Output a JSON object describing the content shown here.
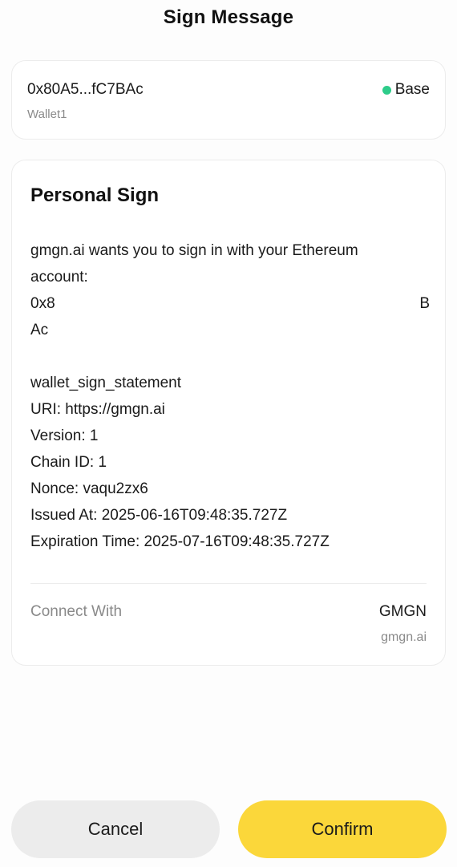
{
  "header": {
    "title": "Sign Message"
  },
  "wallet": {
    "address": "0x80A5...fC7BAc",
    "name": "Wallet1",
    "network": "Base",
    "network_status_color": "#2ecc8a"
  },
  "sign": {
    "title": "Personal Sign",
    "lines": [
      "gmgn.ai wants you to sign in with your Ethereum",
      "account:"
    ],
    "address_line_start": "0x8",
    "address_line_end": "B",
    "address_line2": "Ac",
    "fields": [
      "wallet_sign_statement",
      "URI: https://gmgn.ai",
      "Version: 1",
      "Chain ID: 1",
      "Nonce: vaqu2zx6",
      "Issued At: 2025-06-16T09:48:35.727Z",
      "Expiration Time: 2025-07-16T09:48:35.727Z"
    ]
  },
  "connect": {
    "label": "Connect With",
    "name": "GMGN",
    "domain": "gmgn.ai"
  },
  "actions": {
    "cancel_label": "Cancel",
    "confirm_label": "Confirm",
    "confirm_color": "#fbd73a"
  }
}
